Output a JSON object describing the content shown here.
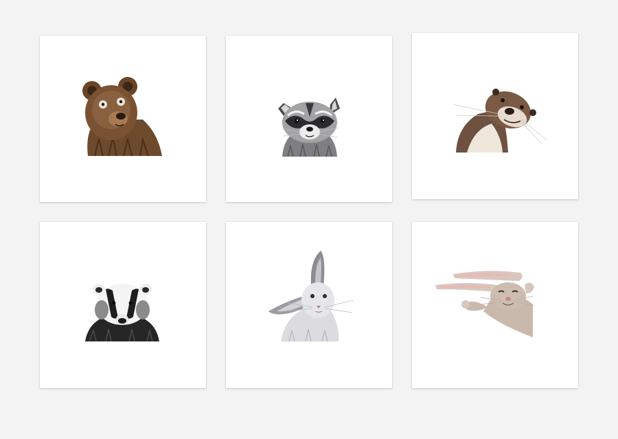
{
  "gallery": {
    "background": "#f3f3f3",
    "cards": [
      {
        "subject": "bear",
        "icon": "bear-illustration",
        "colors": {
          "fur": "#7a5232",
          "dark": "#4a2f1b",
          "light": "#a87a52"
        }
      },
      {
        "subject": "raccoon",
        "icon": "raccoon-illustration",
        "colors": {
          "fur": "#8c8c8e",
          "mask": "#2b2b2d",
          "light": "#f0f0f0"
        }
      },
      {
        "subject": "otter",
        "icon": "otter-illustration",
        "colors": {
          "fur": "#7a5a45",
          "belly": "#efe6dc",
          "dark": "#3b2a20"
        }
      },
      {
        "subject": "badger",
        "icon": "badger-illustration",
        "colors": {
          "fur": "#2a2a2a",
          "stripe": "#f4f4f4",
          "grey": "#8a8a8a"
        }
      },
      {
        "subject": "hare",
        "icon": "hare-illustration",
        "colors": {
          "fur": "#d8d8dc",
          "shade": "#9b9ba2",
          "ear": "#7d7d84"
        }
      },
      {
        "subject": "rabbit",
        "icon": "rabbit-illustration",
        "colors": {
          "fur": "#c9b9ad",
          "ear": "#e9b9b3",
          "dark": "#7a6356"
        }
      }
    ]
  }
}
